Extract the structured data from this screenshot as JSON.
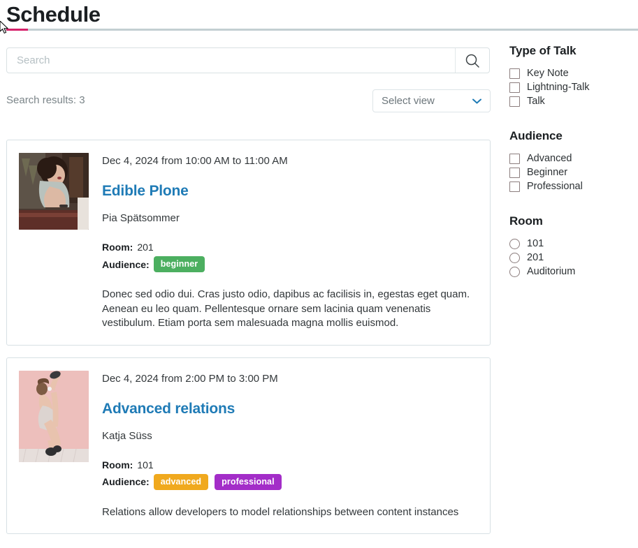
{
  "header": {
    "title": "Schedule",
    "accent_color": "#d6216a",
    "rule_color": "#c3cfd2"
  },
  "search": {
    "placeholder": "Search",
    "value": "",
    "icon": "search-icon"
  },
  "results": {
    "count_label": "Search results: 3"
  },
  "select_view": {
    "selected": "Select view",
    "icon": "chevron-down-icon",
    "chevron_color": "#1f7bb6"
  },
  "cards": [
    {
      "date": "Dec 4, 2024 from 10:00 AM to 11:00 AM",
      "title": "Edible Plone",
      "speaker": "Pia Spätsommer",
      "room_label": "Room:",
      "room_value": "201",
      "audience_label": "Audience:",
      "audience": [
        {
          "text": "beginner",
          "color": "#4caf60"
        }
      ],
      "description": "Donec sed odio dui. Cras justo odio, dapibus ac facilisis in, egestas eget quam. Aenean eu leo quam. Pellentesque ornare sem lacinia quam venenatis vestibulum. Etiam porta sem malesuada magna mollis euismod.",
      "thumbnail": "portrait-woman-seated-vintage-photo"
    },
    {
      "date": "Dec 4, 2024 from 2:00 PM to 3:00 PM",
      "title": "Advanced relations",
      "speaker": "Katja Süss",
      "room_label": "Room:",
      "room_value": "101",
      "audience_label": "Audience:",
      "audience": [
        {
          "text": "advanced",
          "color": "#f0a91e"
        },
        {
          "text": "professional",
          "color": "#a32dc8"
        }
      ],
      "description": "Relations allow developers to model relationships between content instances",
      "thumbnail": "dancer-against-pink-wall-photo"
    }
  ],
  "filters": [
    {
      "heading": "Type of Talk",
      "control": "checkbox",
      "options": [
        "Key Note",
        "Lightning-Talk",
        "Talk"
      ]
    },
    {
      "heading": "Audience",
      "control": "checkbox",
      "options": [
        "Advanced",
        "Beginner",
        "Professional"
      ]
    },
    {
      "heading": "Room",
      "control": "radio",
      "options": [
        "101",
        "201",
        "Auditorium"
      ]
    }
  ]
}
